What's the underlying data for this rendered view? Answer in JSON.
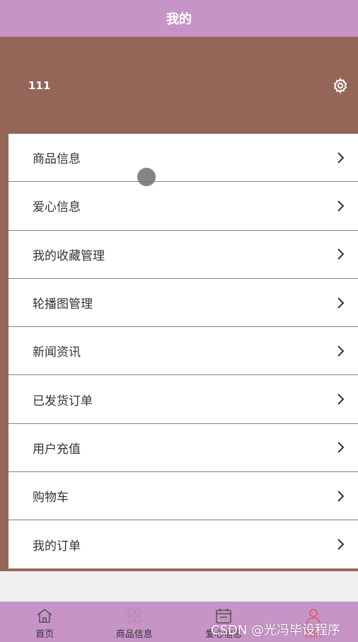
{
  "header": {
    "title": "我的"
  },
  "profile": {
    "username": "111"
  },
  "menu": {
    "items": [
      {
        "label": "商品信息"
      },
      {
        "label": "爱心信息"
      },
      {
        "label": "我的收藏管理"
      },
      {
        "label": "轮播图管理"
      },
      {
        "label": "新闻资讯"
      },
      {
        "label": "已发货订单"
      },
      {
        "label": "用户充值"
      },
      {
        "label": "购物车"
      },
      {
        "label": "我的订单"
      }
    ]
  },
  "tabbar": {
    "tabs": [
      {
        "label": "首页",
        "icon": "home-icon"
      },
      {
        "label": "商品信息",
        "icon": "grid-icon"
      },
      {
        "label": "爱心信息",
        "icon": "calendar-icon"
      },
      {
        "label": "我的",
        "icon": "user-icon",
        "active": true
      }
    ]
  },
  "watermark": {
    "text": "CSDN @光冯毕设程序"
  },
  "colors": {
    "header_bg": "#c794c7",
    "profile_bg": "#946658",
    "tab_active": "#e05a6a",
    "page_bg": "#efefef"
  }
}
